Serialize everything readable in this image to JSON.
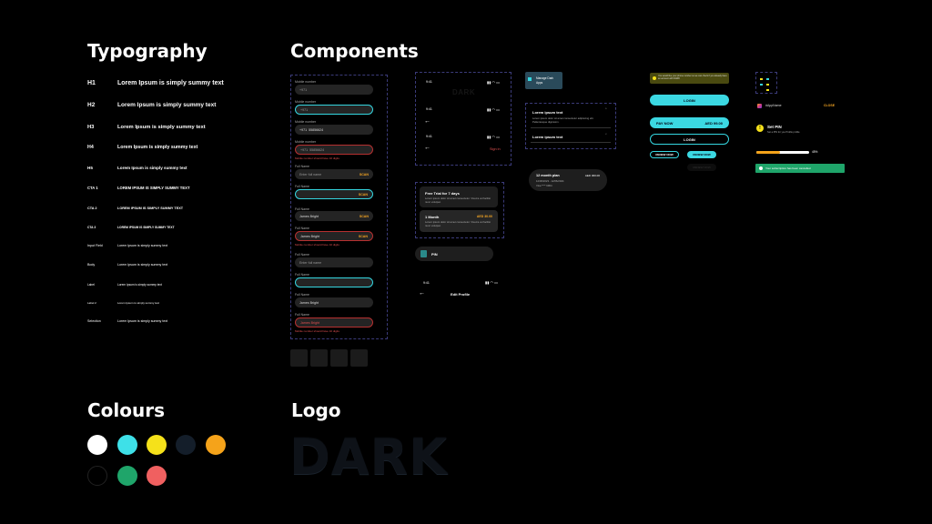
{
  "sections": {
    "typography": "Typography",
    "components": "Components",
    "colours": "Colours",
    "logo": "Logo"
  },
  "typography": [
    {
      "name": "H1",
      "sample": "Lorem Ipsum is simply summy text"
    },
    {
      "name": "H2",
      "sample": "Lorem Ipsum is simply summy text"
    },
    {
      "name": "H3",
      "sample": "Lorem Ipsum is simply summy text"
    },
    {
      "name": "H4",
      "sample": "Lorem Ipsum is simply summy text"
    },
    {
      "name": "H5",
      "sample": "Lorem Ipsum is simply summy text"
    },
    {
      "name": "CTA 1",
      "sample": "LOREM IPSUM IS SIMPLY SUMMY TEXT"
    },
    {
      "name": "CTA 2",
      "sample": "LOREM IPSUM IS SIMPLY SUMMY TEXT"
    },
    {
      "name": "CTA 3",
      "sample": "LOREM IPSUM IS SIMPLY SUMMY TEXT"
    },
    {
      "name": "Input Field",
      "sample": "Lorem Ipsum is simply summy text"
    },
    {
      "name": "Body",
      "sample": "Lorem Ipsum is simply summy text"
    },
    {
      "name": "Label",
      "sample": "Lorem Ipsum is simply summy text"
    },
    {
      "name": "Label 2",
      "sample": "Lorem Ipsum is simply summy text"
    },
    {
      "name": "Selection",
      "sample": "Lorem Ipsum is simply summy text"
    }
  ],
  "form": {
    "mobile_label": "Mobile number",
    "fullname_label": "Full Name",
    "country_code": "+971",
    "phone_value": "55856624",
    "fullname_placeholder": "Enter full name",
    "fullname_value": "James Bright",
    "scan_label": "SCAN",
    "error_text": "Mobile number should have 10 digits"
  },
  "phones": {
    "time": "9:41",
    "sign_in": "Sign in",
    "edit_profile": "Edit Profile",
    "logo_text": "DARK"
  },
  "cards": {
    "trial_title": "Free Trial for 7 days",
    "trial_body": "Lorem ipsum dolor sit amet consectetur. Viverra vel facilisi nunc volutpat.",
    "month_title": "1 Month",
    "month_price": "AED 30.00",
    "month_body": "Lorem ipsum dolor sit amet consectetur. Viverra vel facilisi nunc volutpat.",
    "pin_label": "PIN",
    "manage_label": "Manage Dark Apps",
    "plan_title": "12 month plan",
    "plan_price": "AED 300.00",
    "plan_date": "12/06/2023 - 12/06/2024",
    "plan_card": "Visa **** 6964"
  },
  "accordion": {
    "item1": "Lorem ipsum text",
    "body1": "Lorem ipsum dolor sit amet consectetur adipiscing elit. Pellentesque dignissim.",
    "item2": "Lorem ipsum text",
    "item3": "Lorem ipsum text"
  },
  "buttons": {
    "notice": "You would like your phone number so we can check if you already have an account with DARK",
    "login": "LOGIN",
    "pay_now": "PAY NOW",
    "pay_price": "AED 99.00",
    "login_outline": "LOGIN",
    "renew1": "RENEW NOW",
    "renew2": "RENEW NOW",
    "renew3": "RENEW NOW"
  },
  "right": {
    "instagram": "#AppName",
    "close": "CLOSE",
    "set_pin": "Set PIN",
    "set_pin_sub": "Set a PIN for you Profile profile",
    "progress_label": "45%",
    "progress": 0.45,
    "toast": "Your subscription has been cancelled"
  },
  "colours": [
    "#ffffff",
    "#3ee0e8",
    "#f5e11a",
    "#141e2a",
    "#f5a31a",
    "#000000",
    "#1fa56a",
    "#f06060"
  ],
  "logo": {
    "text": "DARK"
  }
}
